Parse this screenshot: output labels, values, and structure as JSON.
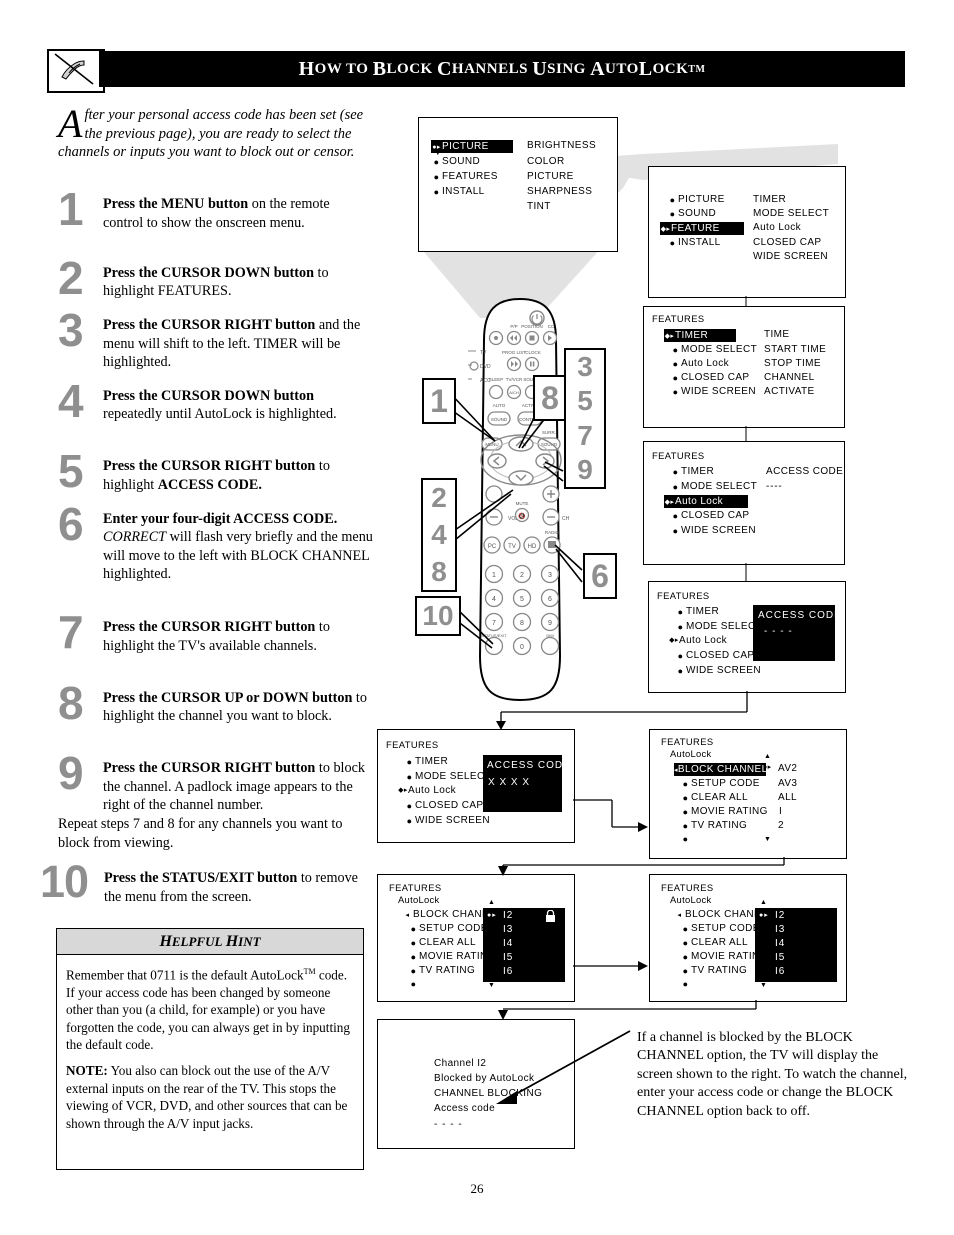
{
  "header": {
    "title_parts": [
      "H",
      "OW TO ",
      "B",
      "LOCK ",
      "C",
      "HANNELS ",
      "U",
      "SING ",
      "A",
      "UTO",
      "L",
      "OCK"
    ],
    "title_plain": "How to Block Channels Using AutoLock",
    "trademark": "TM",
    "logo_icon": "hand-pointing-icon"
  },
  "intro": {
    "dropcap": "A",
    "text": "fter your personal access code has been set (see the previous page), you are ready to select the channels or inputs you want to block out or censor."
  },
  "steps": [
    {
      "num": "1",
      "bold": "Press the MENU button",
      "rest": " on the remote control to show the onscreen menu."
    },
    {
      "num": "2",
      "bold": "Press the CURSOR DOWN button",
      "rest": " to highlight FEATURES."
    },
    {
      "num": "3",
      "bold": "Press the CURSOR RIGHT button",
      "rest": " and the menu will shift to the left. TIMER will be highlighted."
    },
    {
      "num": "4",
      "bold": "Press the CURSOR DOWN button",
      "rest": " repeatedly until AutoLock is highlighted."
    },
    {
      "num": "5",
      "bold": "Press the CURSOR RIGHT button",
      "rest": " to highlight ",
      "bold2": "ACCESS CODE."
    },
    {
      "num": "6",
      "bold": "Enter your four-digit ACCESS CODE.",
      "italic": " CORRECT",
      "rest": " will flash very briefly and the menu will move to the left with BLOCK CHANNEL highlighted."
    },
    {
      "num": "7",
      "bold": "Press the CURSOR RIGHT button",
      "rest": " to highlight the TV's available channels."
    },
    {
      "num": "8",
      "bold": "Press the CURSOR UP or DOWN button",
      "rest": " to highlight the channel you want to block."
    },
    {
      "num": "9",
      "bold": "Press the CURSOR RIGHT button",
      "rest": " to block the channel.  A padlock image appears to the right of the channel number."
    },
    {
      "num": "10",
      "bold": "Press the STATUS/EXIT button",
      "rest": " to remove the menu from the screen."
    }
  ],
  "repeat_note": "Repeat steps 7 and 8 for any channels you want to block from viewing.",
  "hint": {
    "heading_parts": [
      "H",
      "ELPFUL ",
      "H",
      "INT"
    ],
    "heading_plain": "Helpful Hint",
    "para1_a": "Remember that 0711 is the default AutoLock",
    "para1_tm": "TM",
    "para1_b": " code.  If your access code has been changed by someone other than you (a child, for example) or you have forgotten the code, you can always get in by inputting the default code.",
    "note_label": "NOTE:",
    "note_text": "  You also can block out the use of the A/V external inputs on the rear of the TV.  This stops the viewing of VCR, DVD, and other sources that can be shown through the A/V input jacks."
  },
  "osd": {
    "menu1": {
      "left": [
        {
          "label": "PICTURE",
          "highlighted": true
        },
        {
          "label": "SOUND",
          "highlighted": false
        },
        {
          "label": "FEATURES",
          "highlighted": false
        },
        {
          "label": "INSTALL",
          "highlighted": false
        }
      ],
      "right": [
        "BRIGHTNESS",
        "COLOR",
        "PICTURE",
        "SHARPNESS",
        "TINT"
      ]
    },
    "menu2": {
      "left": [
        {
          "label": "PICTURE",
          "highlighted": false
        },
        {
          "label": "SOUND",
          "highlighted": false
        },
        {
          "label": "FEATURE",
          "highlighted": true
        },
        {
          "label": "INSTALL",
          "highlighted": false
        }
      ],
      "right": [
        "TIMER",
        "MODE SELECT",
        "Auto Lock",
        "CLOSED CAP",
        "WIDE SCREEN"
      ]
    },
    "menu3": {
      "title": "FEATURES",
      "left": [
        {
          "label": "TIMER",
          "highlighted": true
        },
        {
          "label": "MODE SELECT",
          "highlighted": false
        },
        {
          "label": "Auto Lock",
          "highlighted": false
        },
        {
          "label": "CLOSED CAP",
          "highlighted": false
        },
        {
          "label": "WIDE SCREEN",
          "highlighted": false
        }
      ],
      "right": [
        "TIME",
        "START TIME",
        "STOP TIME",
        "CHANNEL",
        "ACTIVATE"
      ]
    },
    "menu4": {
      "title": "FEATURES",
      "left": [
        {
          "label": "TIMER",
          "highlighted": false
        },
        {
          "label": "MODE SELECT",
          "highlighted": false
        },
        {
          "label": "Auto Lock",
          "highlighted": true
        },
        {
          "label": "CLOSED CAP",
          "highlighted": false
        },
        {
          "label": "WIDE SCREEN",
          "highlighted": false
        }
      ],
      "right": [
        "ACCESS CODE",
        "- - - -"
      ]
    },
    "menu5": {
      "title": "FEATURES",
      "left": [
        {
          "label": "TIMER",
          "highlighted": false
        },
        {
          "label": "MODE SELECT",
          "highlighted": false
        },
        {
          "label": "Auto Lock",
          "highlighted": false,
          "cursor": true
        },
        {
          "label": "CLOSED CAP",
          "highlighted": false
        },
        {
          "label": "WIDE SCREEN",
          "highlighted": false
        }
      ],
      "panel_title": "ACCESS CODE",
      "panel_value": "- - - -"
    },
    "menu6": {
      "title": "FEATURES",
      "left": [
        {
          "label": "TIMER",
          "highlighted": false
        },
        {
          "label": "MODE SELECT",
          "highlighted": false
        },
        {
          "label": "Auto Lock",
          "highlighted": false,
          "cursor": true
        },
        {
          "label": "CLOSED CAP",
          "highlighted": false
        },
        {
          "label": "WIDE SCREEN",
          "highlighted": false
        }
      ],
      "panel_title": "ACCESS CODE",
      "panel_value": "X X X X"
    },
    "menu7": {
      "title": "FEATURES",
      "subtitle": "AutoLock",
      "left": [
        {
          "label": "BLOCK CHANNEL",
          "highlighted": true
        },
        {
          "label": "SETUP CODE",
          "highlighted": false
        },
        {
          "label": "CLEAR ALL",
          "highlighted": false
        },
        {
          "label": "MOVIE RATING",
          "highlighted": false
        },
        {
          "label": "TV RATING",
          "highlighted": false
        },
        {
          "label": "",
          "highlighted": false
        }
      ],
      "right": [
        "AV2",
        "AV3",
        "ALL",
        "I",
        "2"
      ]
    },
    "menu8": {
      "title": "FEATURES",
      "subtitle": "AutoLock",
      "left": [
        {
          "label": "BLOCK CHANNEL",
          "highlighted": false
        },
        {
          "label": "SETUP CODE",
          "highlighted": false
        },
        {
          "label": "CLEAR ALL",
          "highlighted": false
        },
        {
          "label": "MOVIE RATING",
          "highlighted": false
        },
        {
          "label": "TV RATING",
          "highlighted": false
        },
        {
          "label": "",
          "highlighted": false
        }
      ],
      "channels": [
        "I2",
        "I3",
        "I4",
        "I5",
        "I6"
      ],
      "lock_on_first": true
    },
    "menu9": {
      "title": "FEATURES",
      "subtitle": "AutoLock",
      "left": [
        {
          "label": "BLOCK CHANNEL",
          "highlighted": false
        },
        {
          "label": "SETUP CODE",
          "highlighted": false
        },
        {
          "label": "CLEAR ALL",
          "highlighted": false
        },
        {
          "label": "MOVIE RATING",
          "highlighted": false
        },
        {
          "label": "TV RATING",
          "highlighted": false
        },
        {
          "label": "",
          "highlighted": false
        }
      ],
      "channels": [
        "I2",
        "I3",
        "I4",
        "I5",
        "I6"
      ],
      "lock_on_first": false
    },
    "blocked_screen": {
      "lines": [
        "Channel I2",
        "Blocked by AutoLock",
        "CHANNEL BLOCKING",
        "Access code",
        "- - - -"
      ]
    }
  },
  "remote": {
    "labels_top": [
      "P/P",
      "POSITION",
      "CC",
      "PROG LIST",
      "CLOCK",
      "SLEEP",
      "TV/VCR",
      "SOURCE",
      "FORMAT",
      "AUTO",
      "ACTIVE"
    ],
    "side_labels": [
      "TV",
      "DVD",
      "ACC"
    ],
    "buttons": {
      "auto_sound": "SOUND",
      "active_control": "CONTROL",
      "menu": "MENU",
      "surround": "SOUND",
      "surround_label": "SURR.",
      "vol": "VOL",
      "ch": "CH",
      "mute": "MUTE",
      "radio": "RADIO",
      "status_exit": "STATUS/EXIT",
      "dim": "DIM"
    },
    "source_keys": [
      "PC",
      "TV",
      "HD"
    ],
    "keypad": [
      "1",
      "2",
      "3",
      "4",
      "5",
      "6",
      "7",
      "8",
      "9",
      "0"
    ]
  },
  "callouts": {
    "left_top": "1",
    "left_bottom": [
      "2",
      "4",
      "8"
    ],
    "right_stack": [
      "3",
      "5",
      "7",
      "9"
    ],
    "top_right": "8",
    "keypad": "6",
    "bottom": "10"
  },
  "caption": "If a channel is blocked by the BLOCK CHANNEL option, the TV will display the screen shown to the right. To watch the channel, enter your access code or change the BLOCK CHANNEL option back to off.",
  "page_number": "26"
}
